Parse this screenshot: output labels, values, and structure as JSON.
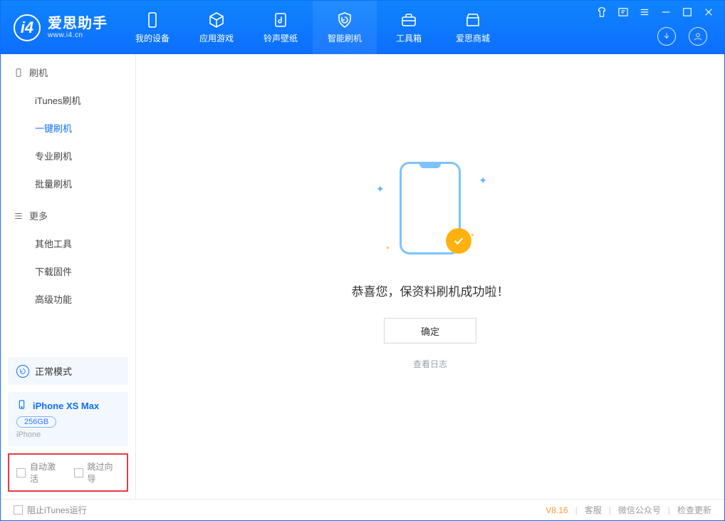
{
  "brand": {
    "name": "爱思助手",
    "site": "www.i4.cn"
  },
  "topnav": {
    "items": [
      {
        "label": "我的设备"
      },
      {
        "label": "应用游戏"
      },
      {
        "label": "铃声壁纸"
      },
      {
        "label": "智能刷机"
      },
      {
        "label": "工具箱"
      },
      {
        "label": "爱思商城"
      }
    ],
    "active_index": 3
  },
  "sidebar": {
    "sections": [
      {
        "title": "刷机",
        "items": [
          "iTunes刷机",
          "一键刷机",
          "专业刷机",
          "批量刷机"
        ],
        "active_index": 1
      },
      {
        "title": "更多",
        "items": [
          "其他工具",
          "下载固件",
          "高级功能"
        ],
        "active_index": -1
      }
    ],
    "mode_card": "正常模式",
    "device": {
      "name": "iPhone XS Max",
      "capacity": "256GB",
      "type": "iPhone"
    },
    "highlight": {
      "opt1": "自动激活",
      "opt2": "跳过向导"
    }
  },
  "main": {
    "success_msg": "恭喜您，保资料刷机成功啦！",
    "ok_btn": "确定",
    "view_log": "查看日志"
  },
  "statusbar": {
    "block_itunes": "阻止iTunes运行",
    "version": "V8.16",
    "links": [
      "客服",
      "微信公众号",
      "检查更新"
    ]
  }
}
